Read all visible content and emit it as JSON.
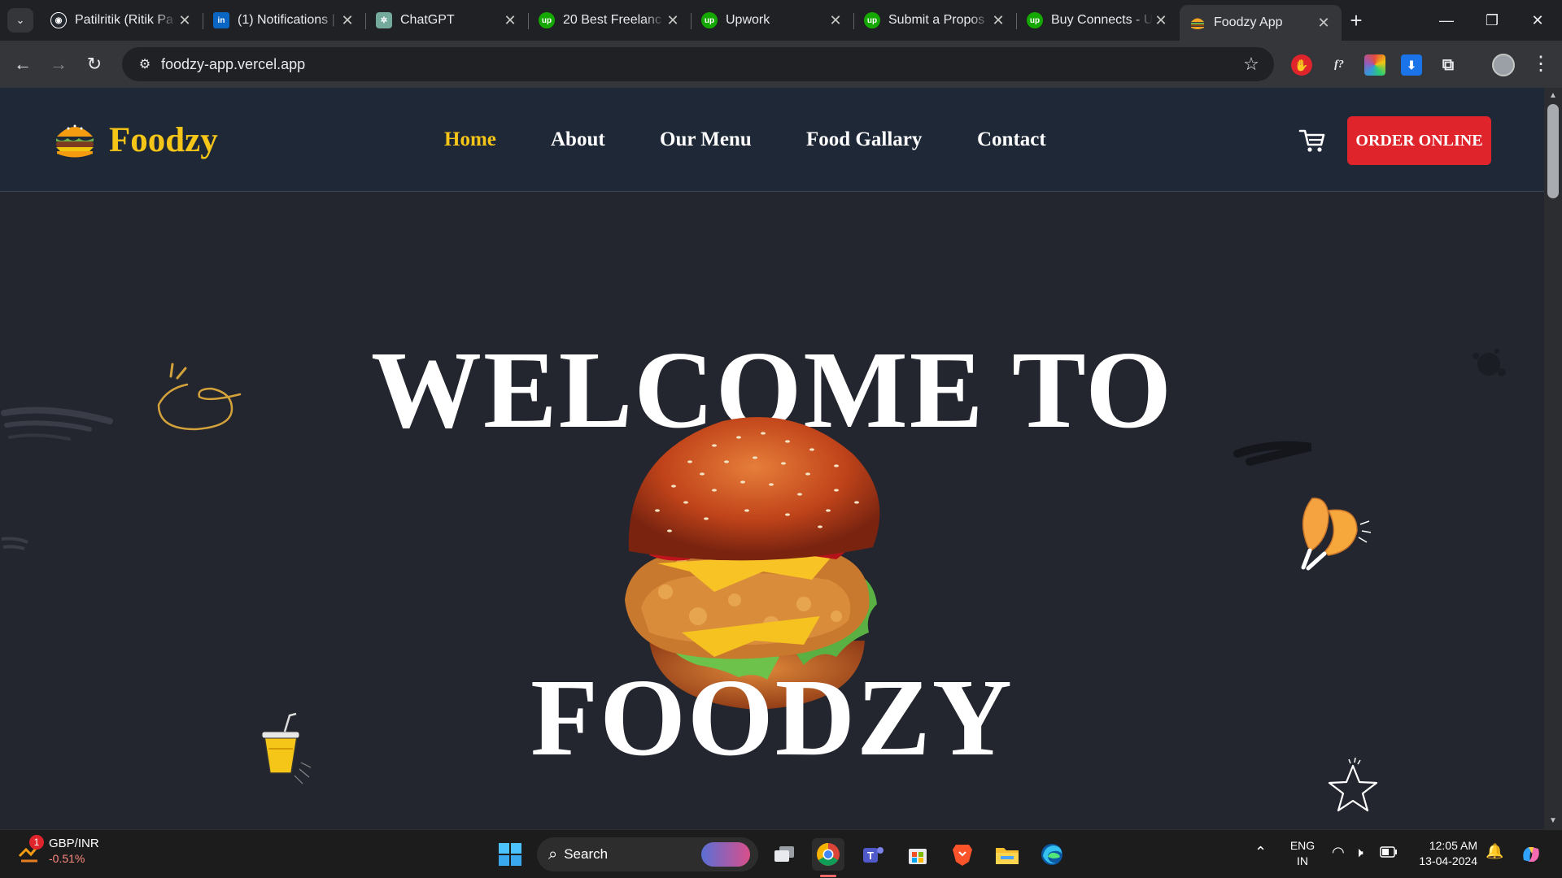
{
  "browser": {
    "tabs": [
      {
        "title": "Patilritik (Ritik Pa",
        "favicon": "github-icon",
        "color": "#ffffff",
        "active": false
      },
      {
        "title": "(1) Notifications |",
        "favicon": "linkedin-icon",
        "color": "#0a66c2",
        "active": false
      },
      {
        "title": "ChatGPT",
        "favicon": "chatgpt-icon",
        "color": "#74aa9c",
        "active": false
      },
      {
        "title": "20 Best Freelanc",
        "favicon": "upwork-icon",
        "color": "#14a800",
        "active": false
      },
      {
        "title": "Upwork",
        "favicon": "upwork-icon",
        "color": "#14a800",
        "active": false
      },
      {
        "title": "Submit a Propos",
        "favicon": "upwork-icon",
        "color": "#14a800",
        "active": false
      },
      {
        "title": "Buy Connects - U",
        "favicon": "upwork-icon",
        "color": "#14a800",
        "active": false
      },
      {
        "title": "Foodzy App",
        "favicon": "burger-icon",
        "color": "#f5a623",
        "active": true
      }
    ],
    "favicon_glyphs": {
      "github": "◉",
      "linkedin": "in",
      "chatgpt": "✲",
      "upwork": "up",
      "burger": "🍔"
    },
    "url": "foodzy-app.vercel.app"
  },
  "site": {
    "brand": "Foodzy",
    "nav": [
      {
        "label": "Home",
        "active": true
      },
      {
        "label": "About",
        "active": false
      },
      {
        "label": "Our Menu",
        "active": false
      },
      {
        "label": "Food Gallary",
        "active": false
      },
      {
        "label": "Contact",
        "active": false
      }
    ],
    "order_button": "ORDER ONLINE",
    "hero_line1": "WELCOME TO",
    "hero_line2": "FOODZY",
    "colors": {
      "accent": "#f5c518",
      "button": "#e0242b",
      "header_bg": "#1f2837",
      "page_bg": "#23252f"
    }
  },
  "taskbar": {
    "widget_title": "GBP/INR",
    "widget_value": "-0.51%",
    "widget_badge": "1",
    "search_label": "Search",
    "lang_line1": "ENG",
    "lang_line2": "IN",
    "time": "12:05 AM",
    "date": "13-04-2024"
  }
}
